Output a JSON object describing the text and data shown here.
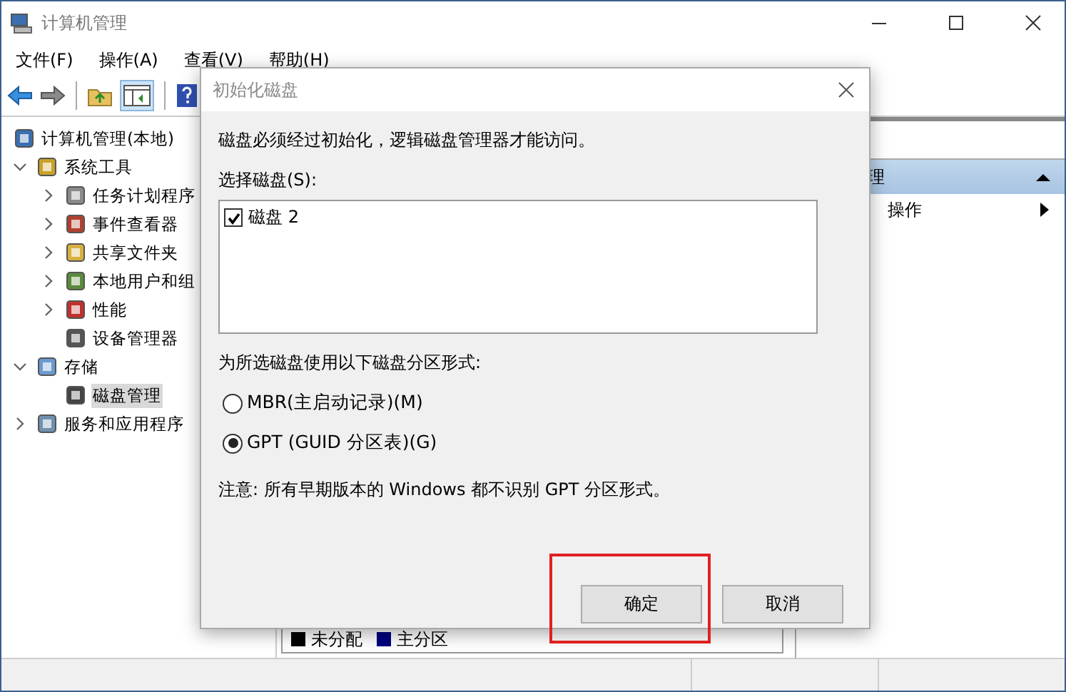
{
  "window": {
    "title": "计算机管理"
  },
  "menu": [
    "文件(F)",
    "操作(A)",
    "查看(V)",
    "帮助(H)"
  ],
  "tree": [
    {
      "label": "计算机管理(本地)",
      "selected": false,
      "children": [
        {
          "label": "系统工具",
          "expanded": true,
          "selected": false,
          "children": [
            {
              "label": "任务计划程序",
              "expanded": false,
              "selected": false
            },
            {
              "label": "事件查看器",
              "expanded": false,
              "selected": false
            },
            {
              "label": "共享文件夹",
              "expanded": false,
              "selected": false
            },
            {
              "label": "本地用户和组",
              "expanded": false,
              "selected": false
            },
            {
              "label": "性能",
              "expanded": false,
              "selected": false
            },
            {
              "label": "设备管理器",
              "selected": false
            }
          ]
        },
        {
          "label": "存储",
          "expanded": true,
          "selected": false,
          "children": [
            {
              "label": "磁盘管理",
              "selected": true
            }
          ]
        },
        {
          "label": "服务和应用程序",
          "expanded": false,
          "selected": false
        }
      ]
    }
  ],
  "legend": [
    {
      "label": "未分配",
      "color": "#000000"
    },
    {
      "label": "主分区",
      "color": "#000080"
    }
  ],
  "actions": {
    "header": "理",
    "items": [
      "操作"
    ]
  },
  "dialog": {
    "title": "初始化磁盘",
    "message": "磁盘必须经过初始化，逻辑磁盘管理器才能访问。",
    "disk_label": "选择磁盘(S):",
    "disks": [
      {
        "label": "磁盘 2",
        "checked": true
      }
    ],
    "style_label": "为所选磁盘使用以下磁盘分区形式:",
    "styles": [
      {
        "label": "MBR(主启动记录)(M)",
        "selected": false
      },
      {
        "label": "GPT (GUID 分区表)(G)",
        "selected": true
      }
    ],
    "note": "注意: 所有早期版本的 Windows 都不识别 GPT 分区形式。",
    "buttons": [
      {
        "label": "确定",
        "highlighted": true
      },
      {
        "label": "取消",
        "highlighted": false
      }
    ]
  }
}
